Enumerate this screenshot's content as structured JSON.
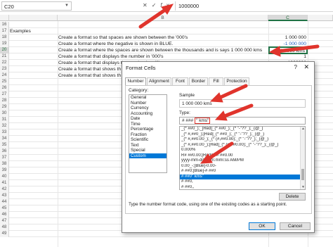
{
  "formula_bar": {
    "name_box": "C20",
    "fx_symbol": "fx",
    "cancel_symbol": "✕",
    "enter_symbol": "✓",
    "value": "1000000"
  },
  "columns": {
    "main": "B",
    "c": "C"
  },
  "rows": [
    {
      "num": "16",
      "b": "",
      "text": "",
      "c": ""
    },
    {
      "num": "17",
      "b": "Examples",
      "text": "",
      "c": ""
    },
    {
      "num": "18",
      "b": "",
      "text": "Create a format so that spaces are shown between the '000's",
      "c": "1 000 000"
    },
    {
      "num": "19",
      "b": "",
      "text": "Create a format where the negative is shown in BLUE.",
      "c": "-1 000 000"
    },
    {
      "num": "20",
      "b": "",
      "text": "Create a format where the spaces are shown between the thousands and is says 1 000 000 kms",
      "c": "1 000 000 kms"
    },
    {
      "num": "21",
      "b": "",
      "text": "Create a format that displays the number in '000's",
      "c": "1"
    },
    {
      "num": "22",
      "b": "",
      "text": "Create a format that displays the number in millions",
      "c": "1000000"
    },
    {
      "num": "23",
      "b": "",
      "text": "Create a format that shows th",
      "c": ""
    },
    {
      "num": "24",
      "b": "",
      "text": "Create a format that shows th",
      "c": ""
    },
    {
      "num": "25",
      "b": "",
      "text": "",
      "c": ""
    },
    {
      "num": "26",
      "b": "",
      "text": "",
      "c": ""
    },
    {
      "num": "27",
      "b": "",
      "text": "",
      "c": ""
    },
    {
      "num": "28",
      "b": "",
      "text": "",
      "c": ""
    },
    {
      "num": "29",
      "b": "",
      "text": "",
      "c": ""
    },
    {
      "num": "30",
      "b": "",
      "text": "",
      "c": ""
    },
    {
      "num": "31",
      "b": "",
      "text": "",
      "c": ""
    },
    {
      "num": "32",
      "b": "",
      "text": "",
      "c": ""
    },
    {
      "num": "33",
      "b": "",
      "text": "",
      "c": ""
    },
    {
      "num": "34",
      "b": "",
      "text": "",
      "c": ""
    },
    {
      "num": "35",
      "b": "",
      "text": "",
      "c": ""
    },
    {
      "num": "36",
      "b": "",
      "text": "",
      "c": ""
    },
    {
      "num": "37",
      "b": "",
      "text": "",
      "c": ""
    },
    {
      "num": "38",
      "b": "",
      "text": "",
      "c": ""
    },
    {
      "num": "39",
      "b": "",
      "text": "",
      "c": ""
    },
    {
      "num": "40",
      "b": "",
      "text": "",
      "c": ""
    },
    {
      "num": "41",
      "b": "",
      "text": "",
      "c": ""
    },
    {
      "num": "42",
      "b": "",
      "text": "",
      "c": ""
    },
    {
      "num": "43",
      "b": "",
      "text": "",
      "c": ""
    },
    {
      "num": "44",
      "b": "",
      "text": "",
      "c": ""
    },
    {
      "num": "45",
      "b": "",
      "text": "",
      "c": ""
    },
    {
      "num": "46",
      "b": "",
      "text": "",
      "c": ""
    },
    {
      "num": "47",
      "b": "",
      "text": "",
      "c": ""
    },
    {
      "num": "48",
      "b": "",
      "text": "",
      "c": ""
    },
    {
      "num": "49",
      "b": "",
      "text": "",
      "c": ""
    }
  ],
  "active_row": "20",
  "dialog": {
    "title": "Format Cells",
    "help": "?",
    "close": "✕",
    "tabs": [
      "Number",
      "Alignment",
      "Font",
      "Border",
      "Fill",
      "Protection"
    ],
    "category_label": "Category:",
    "categories": [
      "General",
      "Number",
      "Currency",
      "Accounting",
      "Date",
      "Time",
      "Percentage",
      "Fraction",
      "Scientific",
      "Text",
      "Special",
      "Custom"
    ],
    "selected_category": "Custom",
    "sample_label": "Sample",
    "sample_value": "1 000 000 kms",
    "type_label": "Type:",
    "type_prefix": "# ###",
    "type_highlight": "\" kms\"",
    "formats": [
      "_(* ##0_);_[Red]_(* ##0_);_(* \"-\"??_);_(@_)",
      "_(* #,##0_);[Red]_(* ##0_);_(* \"-\"??_);_(@_)",
      "_(* #,##0.00_);_(* (#,##0.00);_(* \"-\"??_);_(@_)",
      "_(* #,##0.00_);[Red]_(* (#,##0.00);_(* \"-\"??_);_(@_)",
      "0.000%",
      "R# ##0.00;[Red]R-# ##0.00",
      "yyyy-mm-dd\" \"hh\\:mm\\:ss AM/PM",
      "0.00_-;[Blue]-0.00-",
      "# ##0;[Blue]-# ##0",
      "# ##0\" kms\"",
      "# ##0,",
      "# ##0,,"
    ],
    "selected_format": "# ##0\" kms\"",
    "delete_label": "Delete",
    "hint": "Type the number format code, using one of the existing codes as a starting point.",
    "ok_label": "OK",
    "cancel_label": "Cancel"
  },
  "colors": {
    "accent": "#0078d7",
    "excel_green": "#217346",
    "arrow": "#e0342c",
    "negative_blue": "#1f5fbf"
  }
}
